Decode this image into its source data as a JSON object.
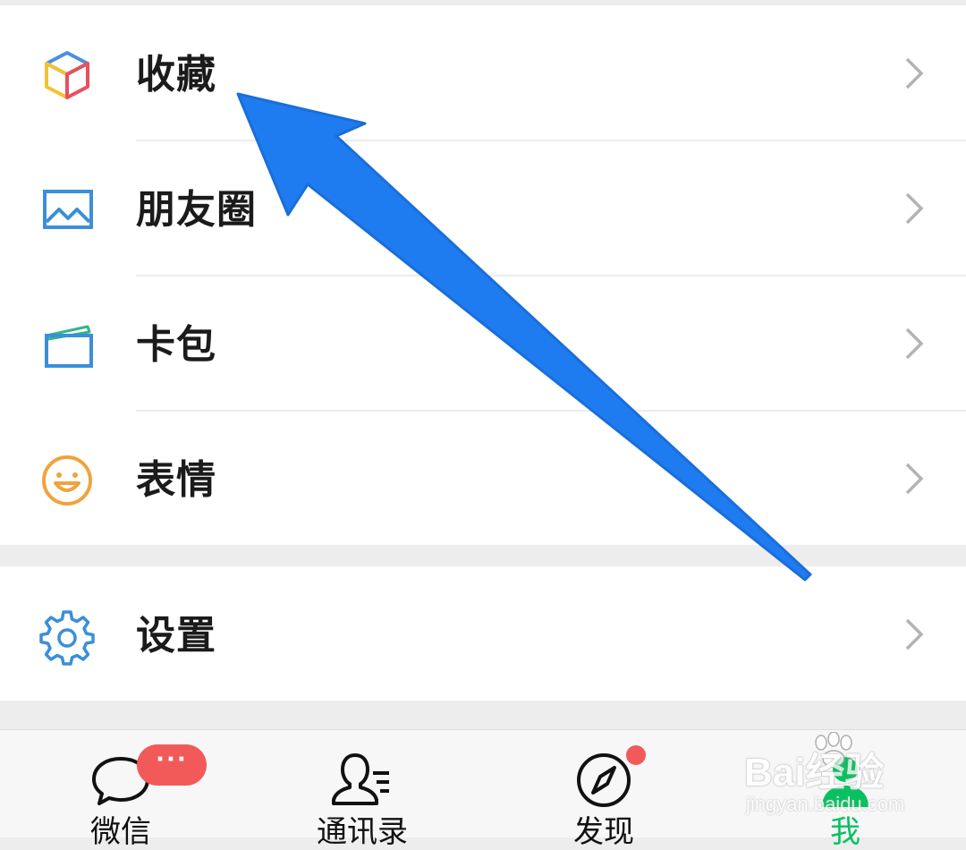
{
  "menu_groups": [
    {
      "items": [
        {
          "label": "收藏",
          "icon": "favorites-cube-icon"
        },
        {
          "label": "朋友圈",
          "icon": "moments-picture-icon"
        },
        {
          "label": "卡包",
          "icon": "card-wallet-icon"
        },
        {
          "label": "表情",
          "icon": "sticker-smiley-icon"
        }
      ]
    },
    {
      "items": [
        {
          "label": "设置",
          "icon": "settings-gear-icon"
        }
      ]
    }
  ],
  "tabbar": {
    "tabs": [
      {
        "label": "微信",
        "icon": "chat-bubble-icon",
        "active": false
      },
      {
        "label": "通讯录",
        "icon": "contacts-icon",
        "active": false
      },
      {
        "label": "发现",
        "icon": "discover-compass-icon",
        "active": false
      },
      {
        "label": "我",
        "icon": "me-person-icon",
        "active": true
      }
    ],
    "chat_badge": "···",
    "discover_badge": "dot"
  },
  "watermark": {
    "brand": "Bai经验",
    "url": "jingyan.baidu.com"
  },
  "colors": {
    "page_background": "#ededed",
    "row_background": "#ffffff",
    "active_tab": "#07c160",
    "badge": "#f25a5a",
    "annotation_arrow": "#1f7bf0"
  }
}
